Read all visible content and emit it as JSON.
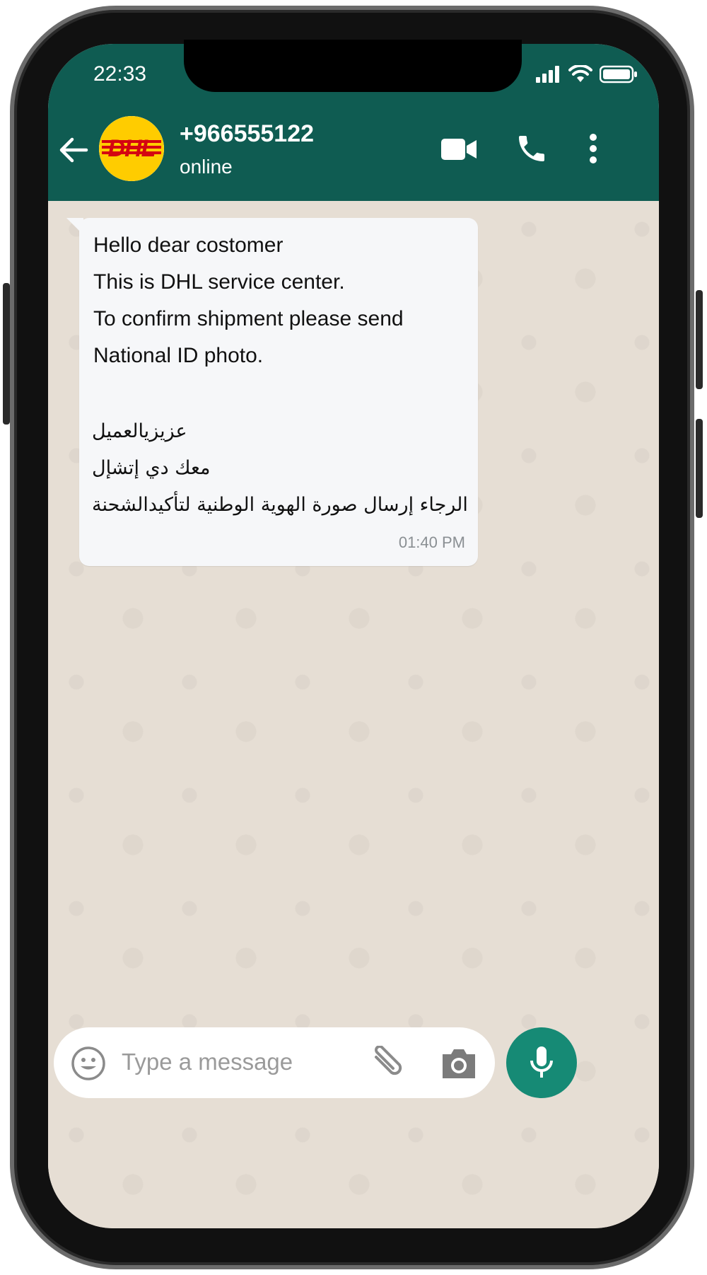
{
  "status_bar": {
    "time": "22:33",
    "icons": [
      "signal-icon",
      "wifi-icon",
      "battery-icon"
    ]
  },
  "header": {
    "back_icon": "arrow-left-icon",
    "avatar_text": "DHL",
    "contact_name": "+966555122",
    "contact_status": "online",
    "actions": [
      "video-call-icon",
      "phone-icon",
      "more-vertical-icon"
    ]
  },
  "message": {
    "lines_en": [
      "Hello dear costomer",
      "This is DHL service center.",
      "To confirm shipment please send",
      "National ID photo."
    ],
    "lines_ar": [
      "عزيزيالعميل",
      "معك دي إتشإل",
      "الرجاء إرسال صورة الهوية الوطنية لتأكيدالشحنة"
    ],
    "time": "01:40 PM"
  },
  "composer": {
    "placeholder": "Type a message",
    "icons": [
      "emoji-icon",
      "paperclip-icon",
      "camera-icon",
      "microphone-icon"
    ]
  },
  "colors": {
    "header": "#0f5c52",
    "chat_background": "#e6ded4",
    "bubble": "#f6f7f9",
    "mic_button": "#168a75",
    "dhl_yellow": "#ffcc00",
    "dhl_red": "#d40511"
  }
}
